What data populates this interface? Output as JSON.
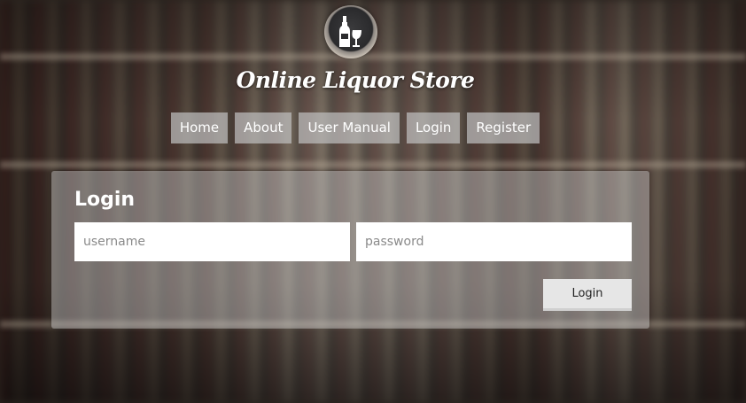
{
  "site": {
    "title": "Online Liquor Store",
    "logo_icon": "wine-bottle-glass-icon"
  },
  "nav": {
    "items": [
      {
        "label": "Home"
      },
      {
        "label": "About"
      },
      {
        "label": "User Manual"
      },
      {
        "label": "Login"
      },
      {
        "label": "Register"
      }
    ]
  },
  "login": {
    "title": "Login",
    "username_placeholder": "username",
    "username_value": "",
    "password_placeholder": "password",
    "password_value": "",
    "submit_label": "Login"
  },
  "colors": {
    "nav_bg": "#bebebe",
    "panel_bg": "#c8c8c8",
    "button_bg": "#e6e6e6",
    "text_light": "#ffffff"
  }
}
